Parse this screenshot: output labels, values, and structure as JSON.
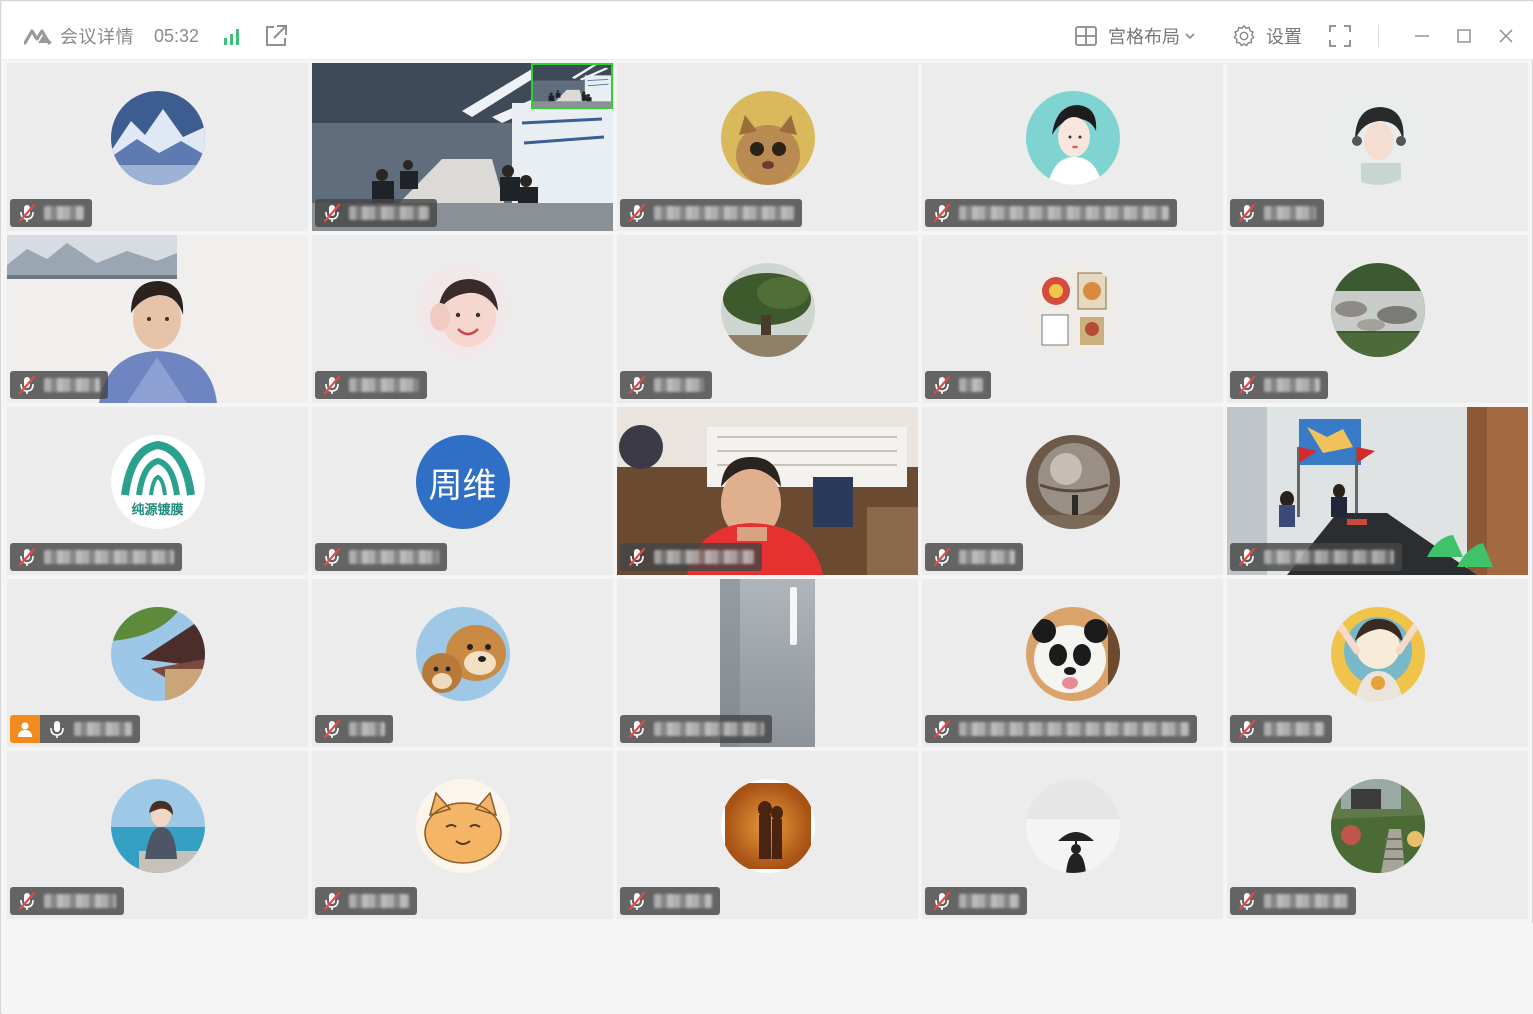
{
  "titlebar": {
    "meeting_info_label": "会议详情",
    "timer": "05:32",
    "layout_label": "宫格布局",
    "settings_label": "设置"
  },
  "tiles": [
    {
      "kind": "avatar",
      "avatar_theme": "snowy-mountain",
      "muted": true
    },
    {
      "kind": "video",
      "video_theme": "conference-room-pip",
      "muted": true
    },
    {
      "kind": "avatar",
      "avatar_theme": "cat-face",
      "muted": true
    },
    {
      "kind": "avatar",
      "avatar_theme": "illustrated-woman",
      "muted": true
    },
    {
      "kind": "avatar",
      "avatar_theme": "woman-headphones",
      "muted": true
    },
    {
      "kind": "video",
      "video_theme": "woman-office",
      "muted": true
    },
    {
      "kind": "avatar",
      "avatar_theme": "girl-waving",
      "muted": true
    },
    {
      "kind": "avatar",
      "avatar_theme": "big-tree",
      "muted": true
    },
    {
      "kind": "avatar",
      "avatar_theme": "wall-art",
      "muted": true
    },
    {
      "kind": "avatar",
      "avatar_theme": "river-rocks",
      "muted": true
    },
    {
      "kind": "logo",
      "logo_text": "纯源镀膜",
      "muted": true
    },
    {
      "kind": "initials",
      "initials": "周维",
      "muted": true
    },
    {
      "kind": "video",
      "video_theme": "man-red-shirt",
      "muted": true
    },
    {
      "kind": "avatar",
      "avatar_theme": "steel-sphere",
      "muted": true
    },
    {
      "kind": "video",
      "video_theme": "meeting-room-flags",
      "muted": true
    },
    {
      "kind": "avatar",
      "avatar_theme": "temple-roof",
      "muted": false,
      "host": true
    },
    {
      "kind": "avatar",
      "avatar_theme": "shiba-dogs",
      "muted": true
    },
    {
      "kind": "strip",
      "muted": true
    },
    {
      "kind": "avatar",
      "avatar_theme": "panda",
      "muted": true
    },
    {
      "kind": "avatar",
      "avatar_theme": "cartoon-girl",
      "muted": true
    },
    {
      "kind": "avatar",
      "avatar_theme": "girl-by-pool",
      "muted": true
    },
    {
      "kind": "avatar",
      "avatar_theme": "orange-cat-drawing",
      "muted": true
    },
    {
      "kind": "avatar",
      "avatar_theme": "sunset-silhouette",
      "muted": true
    },
    {
      "kind": "avatar",
      "avatar_theme": "umbrella-silhouette",
      "muted": true
    },
    {
      "kind": "avatar",
      "avatar_theme": "garden-stairs",
      "muted": true
    }
  ],
  "colors": {
    "accent_signal": "#3cc27a",
    "host_badge": "#f28b1d",
    "pip_border": "#2ed12e",
    "mute_red": "#e34a4a"
  }
}
